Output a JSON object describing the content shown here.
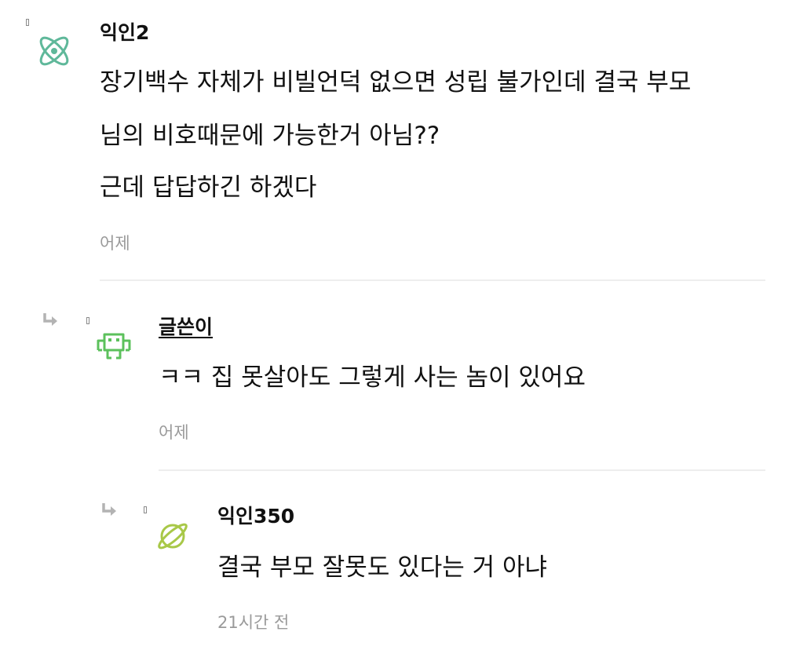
{
  "comments": [
    {
      "author": "익인2",
      "lines": [
        "장기백수 자체가 비빌언덕 없으면 성립 불가인데 결국 부모",
        "님의 비호때문에 가능한거 아님??",
        "근데 답답하긴 하겠다"
      ],
      "time": "어제",
      "avatar_icon": "atom-icon",
      "avatar_color": "#5fb89a"
    },
    {
      "author": "글쓴이",
      "lines": [
        "ㅋㅋ 집 못살아도 그렇게 사는 놈이 있어요"
      ],
      "time": "어제",
      "avatar_icon": "space-invader-icon",
      "avatar_color": "#5cc15c"
    },
    {
      "author": "익인350",
      "lines": [
        "결국 부모 잘못도 있다는 거 아냐"
      ],
      "time": "21시간 전",
      "avatar_icon": "planet-icon",
      "avatar_color": "#a8c848"
    }
  ]
}
